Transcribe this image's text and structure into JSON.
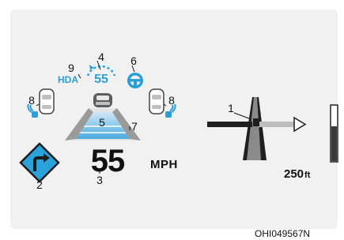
{
  "cluster": {
    "current_speed": "55",
    "speed_unit": "MPH",
    "hda_label": "HDA",
    "set_speed": "55",
    "turn_distance": "250",
    "distance_unit": "ft"
  },
  "callouts": {
    "c1": "1",
    "c2": "2",
    "c3": "3",
    "c4": "4",
    "c5": "5",
    "c6": "6",
    "c7": "7",
    "c8_left": "8",
    "c8_right": "8",
    "c9": "9"
  },
  "figure_code": "OHI049567N",
  "colors": {
    "accent_blue": "#2a9fd6",
    "panel_background": "#f1f1f1",
    "dark": "#111111"
  },
  "icons": [
    "right-turn-sign-icon",
    "lead-vehicle-icon",
    "lane-car-left-icon",
    "lane-car-right-icon",
    "steering-wheel-icon",
    "set-speed-arc-icon",
    "intersection-guidance-icon",
    "distance-bar-icon"
  ]
}
